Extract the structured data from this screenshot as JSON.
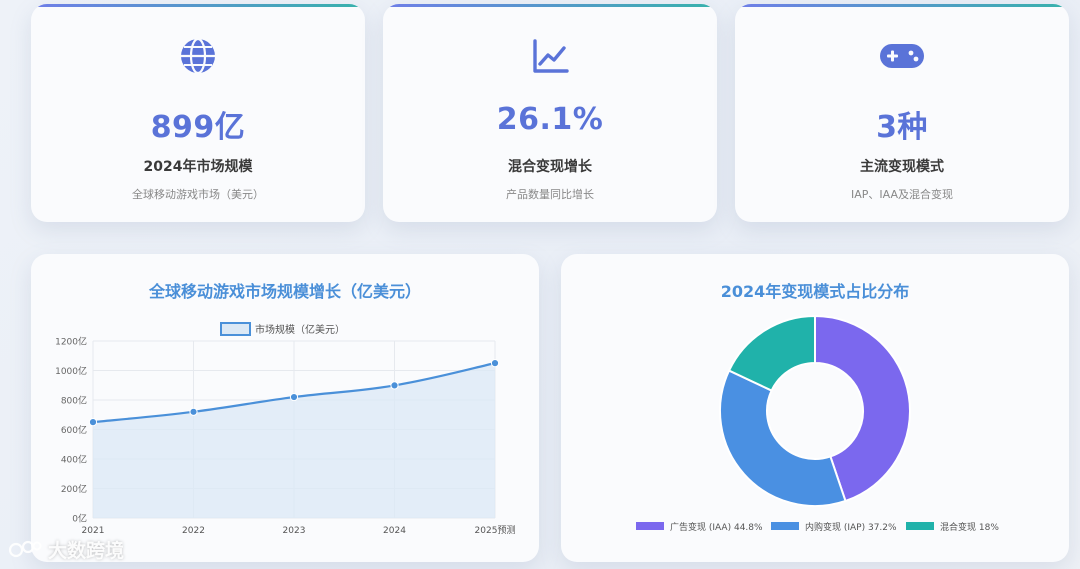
{
  "kpis": [
    {
      "value": "899亿",
      "label": "2024年市场规模",
      "sub": "全球移动游戏市场（美元）",
      "icon": "globe-icon"
    },
    {
      "value": "26.1%",
      "label": "混合变现增长",
      "sub": "产品数量同比增长",
      "icon": "line-chart-icon"
    },
    {
      "value": "3种",
      "label": "主流变现模式",
      "sub": "IAP、IAA及混合变现",
      "icon": "gamepad-icon"
    }
  ],
  "colors": {
    "accent": "#5a73d8",
    "line": "#4a90d9",
    "area_fill": "#dbe8f5",
    "iaa": "#7b68ee",
    "iap": "#4a90e2",
    "hybrid": "#20b2aa",
    "title": "#4a8fd8"
  },
  "chart_data": [
    {
      "type": "line",
      "title": "全球移动游戏市场规模增长（亿美元）",
      "categories": [
        "2021",
        "2022",
        "2023",
        "2024",
        "2025预测"
      ],
      "series": [
        {
          "name": "市场规模（亿美元）",
          "values": [
            650,
            720,
            820,
            899,
            1050
          ]
        }
      ],
      "yticks": [
        "0亿",
        "200亿",
        "400亿",
        "600亿",
        "800亿",
        "1000亿",
        "1200亿"
      ],
      "ylim": [
        0,
        1200
      ],
      "grid": true,
      "legend": "top"
    },
    {
      "type": "pie",
      "title": "2024年变现模式占比分布",
      "labels": [
        "广告变现 (IAA) 44.8%",
        "内购变现 (IAP) 37.2%",
        "混合变现 18%"
      ],
      "values": [
        44.8,
        37.2,
        18
      ],
      "donut": true,
      "legend": "bottom"
    }
  ],
  "watermark": "大数跨境"
}
